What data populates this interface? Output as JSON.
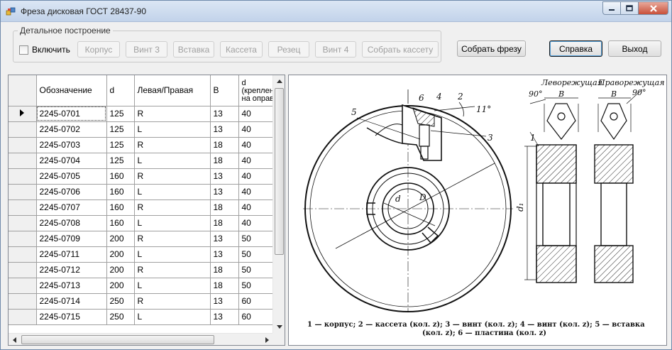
{
  "window": {
    "title": "Фреза дисковая ГОСТ 28437-90"
  },
  "detail_group": {
    "title": "Детальное построение",
    "checkbox_label": "Включить",
    "buttons": [
      "Корпус",
      "Винт 3",
      "Вставка",
      "Кассета",
      "Резец",
      "Винт 4",
      "Собрать кассету"
    ]
  },
  "actions": {
    "assemble": "Собрать фрезу",
    "help": "Справка",
    "exit": "Выход"
  },
  "table": {
    "columns": [
      "Обозначение",
      "d",
      "Левая/Правая",
      "B",
      "d (крепление на оправке)"
    ],
    "column_display": [
      "Обозначение",
      "d",
      "Левая/Правая",
      "B",
      "d\n(креплен\nна оправ"
    ],
    "rows": [
      [
        "2245-0701",
        "125",
        "R",
        "13",
        "40"
      ],
      [
        "2245-0702",
        "125",
        "L",
        "13",
        "40"
      ],
      [
        "2245-0703",
        "125",
        "R",
        "18",
        "40"
      ],
      [
        "2245-0704",
        "125",
        "L",
        "18",
        "40"
      ],
      [
        "2245-0705",
        "160",
        "R",
        "13",
        "40"
      ],
      [
        "2245-0706",
        "160",
        "L",
        "13",
        "40"
      ],
      [
        "2245-0707",
        "160",
        "R",
        "18",
        "40"
      ],
      [
        "2245-0708",
        "160",
        "L",
        "18",
        "40"
      ],
      [
        "2245-0709",
        "200",
        "R",
        "13",
        "50"
      ],
      [
        "2245-0711",
        "200",
        "L",
        "13",
        "50"
      ],
      [
        "2245-0712",
        "200",
        "R",
        "18",
        "50"
      ],
      [
        "2245-0713",
        "200",
        "L",
        "18",
        "50"
      ],
      [
        "2245-0714",
        "250",
        "R",
        "13",
        "60"
      ],
      [
        "2245-0715",
        "250",
        "L",
        "13",
        "60"
      ]
    ],
    "selected_row": 0
  },
  "drawing": {
    "labels": {
      "left_cut": "Леворежущая",
      "right_cut": "Праворежущая",
      "angle_90": "90°",
      "angle_11": "11°",
      "dim_B": "B",
      "dim_d": "d",
      "dim_D": "D",
      "dim_d1": "d₁",
      "callouts": [
        "1",
        "2",
        "3",
        "4",
        "5",
        "6"
      ]
    },
    "legend_line1": "1 — корпус;   2 — кассета  (кол. z);   3 — винт  (кол. z);   4 — винт  (кол. z);   5 — вставка",
    "legend_line2": "(кол. z); 6 — пластина (кол. z)"
  }
}
